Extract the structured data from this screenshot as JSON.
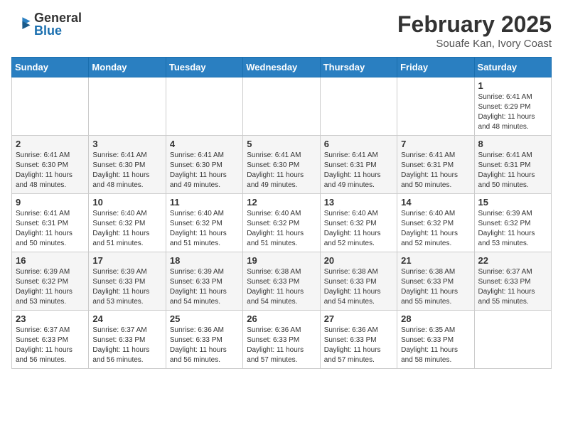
{
  "header": {
    "logo_general": "General",
    "logo_blue": "Blue",
    "month_title": "February 2025",
    "location": "Souafe Kan, Ivory Coast"
  },
  "weekdays": [
    "Sunday",
    "Monday",
    "Tuesday",
    "Wednesday",
    "Thursday",
    "Friday",
    "Saturday"
  ],
  "weeks": [
    [
      {
        "day": "",
        "info": ""
      },
      {
        "day": "",
        "info": ""
      },
      {
        "day": "",
        "info": ""
      },
      {
        "day": "",
        "info": ""
      },
      {
        "day": "",
        "info": ""
      },
      {
        "day": "",
        "info": ""
      },
      {
        "day": "1",
        "info": "Sunrise: 6:41 AM\nSunset: 6:29 PM\nDaylight: 11 hours\nand 48 minutes."
      }
    ],
    [
      {
        "day": "2",
        "info": "Sunrise: 6:41 AM\nSunset: 6:30 PM\nDaylight: 11 hours\nand 48 minutes."
      },
      {
        "day": "3",
        "info": "Sunrise: 6:41 AM\nSunset: 6:30 PM\nDaylight: 11 hours\nand 48 minutes."
      },
      {
        "day": "4",
        "info": "Sunrise: 6:41 AM\nSunset: 6:30 PM\nDaylight: 11 hours\nand 49 minutes."
      },
      {
        "day": "5",
        "info": "Sunrise: 6:41 AM\nSunset: 6:30 PM\nDaylight: 11 hours\nand 49 minutes."
      },
      {
        "day": "6",
        "info": "Sunrise: 6:41 AM\nSunset: 6:31 PM\nDaylight: 11 hours\nand 49 minutes."
      },
      {
        "day": "7",
        "info": "Sunrise: 6:41 AM\nSunset: 6:31 PM\nDaylight: 11 hours\nand 50 minutes."
      },
      {
        "day": "8",
        "info": "Sunrise: 6:41 AM\nSunset: 6:31 PM\nDaylight: 11 hours\nand 50 minutes."
      }
    ],
    [
      {
        "day": "9",
        "info": "Sunrise: 6:41 AM\nSunset: 6:31 PM\nDaylight: 11 hours\nand 50 minutes."
      },
      {
        "day": "10",
        "info": "Sunrise: 6:40 AM\nSunset: 6:32 PM\nDaylight: 11 hours\nand 51 minutes."
      },
      {
        "day": "11",
        "info": "Sunrise: 6:40 AM\nSunset: 6:32 PM\nDaylight: 11 hours\nand 51 minutes."
      },
      {
        "day": "12",
        "info": "Sunrise: 6:40 AM\nSunset: 6:32 PM\nDaylight: 11 hours\nand 51 minutes."
      },
      {
        "day": "13",
        "info": "Sunrise: 6:40 AM\nSunset: 6:32 PM\nDaylight: 11 hours\nand 52 minutes."
      },
      {
        "day": "14",
        "info": "Sunrise: 6:40 AM\nSunset: 6:32 PM\nDaylight: 11 hours\nand 52 minutes."
      },
      {
        "day": "15",
        "info": "Sunrise: 6:39 AM\nSunset: 6:32 PM\nDaylight: 11 hours\nand 53 minutes."
      }
    ],
    [
      {
        "day": "16",
        "info": "Sunrise: 6:39 AM\nSunset: 6:32 PM\nDaylight: 11 hours\nand 53 minutes."
      },
      {
        "day": "17",
        "info": "Sunrise: 6:39 AM\nSunset: 6:33 PM\nDaylight: 11 hours\nand 53 minutes."
      },
      {
        "day": "18",
        "info": "Sunrise: 6:39 AM\nSunset: 6:33 PM\nDaylight: 11 hours\nand 54 minutes."
      },
      {
        "day": "19",
        "info": "Sunrise: 6:38 AM\nSunset: 6:33 PM\nDaylight: 11 hours\nand 54 minutes."
      },
      {
        "day": "20",
        "info": "Sunrise: 6:38 AM\nSunset: 6:33 PM\nDaylight: 11 hours\nand 54 minutes."
      },
      {
        "day": "21",
        "info": "Sunrise: 6:38 AM\nSunset: 6:33 PM\nDaylight: 11 hours\nand 55 minutes."
      },
      {
        "day": "22",
        "info": "Sunrise: 6:37 AM\nSunset: 6:33 PM\nDaylight: 11 hours\nand 55 minutes."
      }
    ],
    [
      {
        "day": "23",
        "info": "Sunrise: 6:37 AM\nSunset: 6:33 PM\nDaylight: 11 hours\nand 56 minutes."
      },
      {
        "day": "24",
        "info": "Sunrise: 6:37 AM\nSunset: 6:33 PM\nDaylight: 11 hours\nand 56 minutes."
      },
      {
        "day": "25",
        "info": "Sunrise: 6:36 AM\nSunset: 6:33 PM\nDaylight: 11 hours\nand 56 minutes."
      },
      {
        "day": "26",
        "info": "Sunrise: 6:36 AM\nSunset: 6:33 PM\nDaylight: 11 hours\nand 57 minutes."
      },
      {
        "day": "27",
        "info": "Sunrise: 6:36 AM\nSunset: 6:33 PM\nDaylight: 11 hours\nand 57 minutes."
      },
      {
        "day": "28",
        "info": "Sunrise: 6:35 AM\nSunset: 6:33 PM\nDaylight: 11 hours\nand 58 minutes."
      },
      {
        "day": "",
        "info": ""
      }
    ]
  ]
}
